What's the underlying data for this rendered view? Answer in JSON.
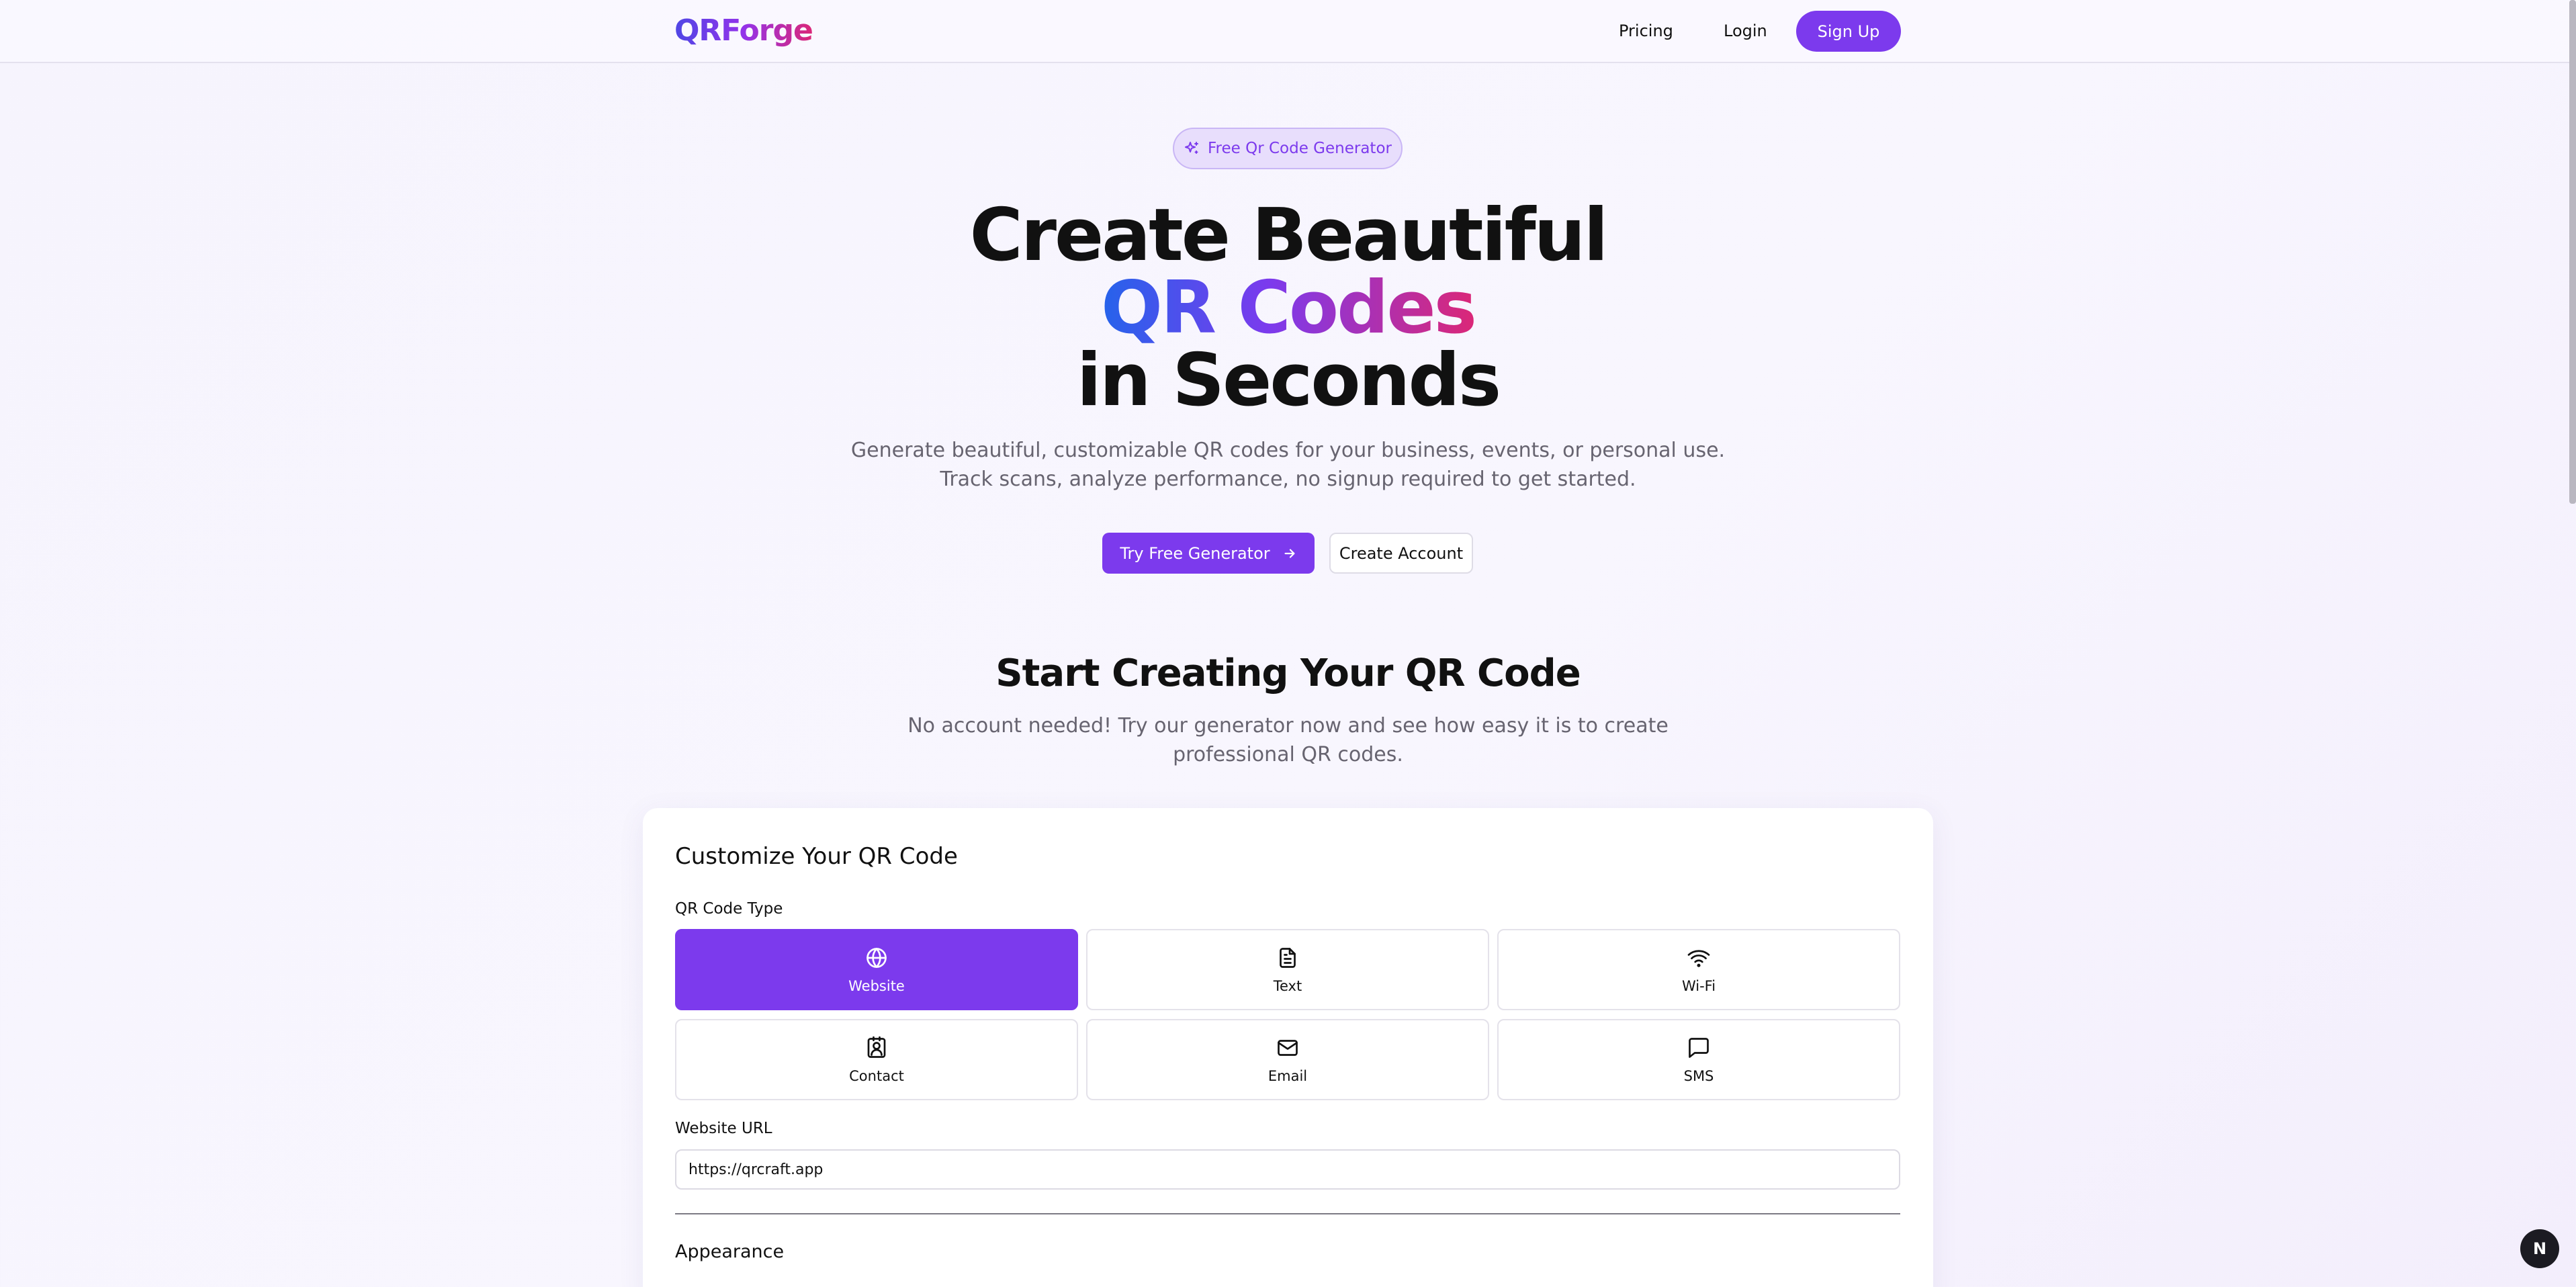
{
  "header": {
    "logo": "QRForge",
    "nav": {
      "pricing": "Pricing",
      "login": "Login",
      "signup": "Sign Up"
    }
  },
  "hero": {
    "badge": "Free Qr Code Generator",
    "line1": "Create Beautiful",
    "line2": "QR Codes",
    "line3": "in Seconds",
    "sub1": "Generate beautiful, customizable QR codes for your business, events, or personal use.",
    "sub2": "Track scans, analyze performance, no signup required to get started.",
    "primary_cta": "Try Free Generator",
    "secondary_cta": "Create Account"
  },
  "section": {
    "title": "Start Creating Your QR Code",
    "sub1": "No account needed! Try our generator now and see how easy it is to create",
    "sub2": "professional QR codes."
  },
  "card": {
    "title": "Customize Your QR Code",
    "type_label": "QR Code Type",
    "types": [
      {
        "label": "Website",
        "icon": "globe-icon",
        "active": true
      },
      {
        "label": "Text",
        "icon": "file-text-icon",
        "active": false
      },
      {
        "label": "Wi-Fi",
        "icon": "wifi-icon",
        "active": false
      },
      {
        "label": "Contact",
        "icon": "contact-icon",
        "active": false
      },
      {
        "label": "Email",
        "icon": "mail-icon",
        "active": false
      },
      {
        "label": "SMS",
        "icon": "message-icon",
        "active": false
      }
    ],
    "url_label": "Website URL",
    "url_value": "https://qrcraft.app",
    "appearance_label": "Appearance"
  },
  "dev_badge": "N",
  "colors": {
    "accent": "#7c3aed",
    "text": "#111111",
    "muted": "#676470"
  }
}
